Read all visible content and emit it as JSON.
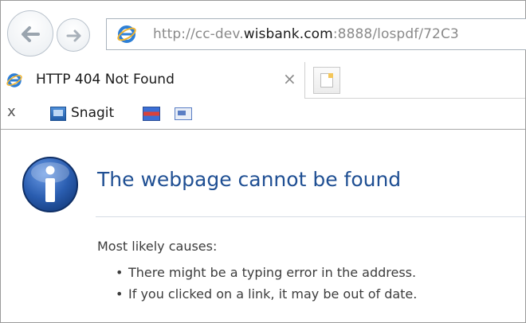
{
  "browser": {
    "address": {
      "url_prefix": "http://cc-dev.",
      "url_domain": "wisbank.com",
      "url_suffix": ":8888/lospdf/72C3"
    },
    "tab": {
      "title": "HTTP 404 Not Found",
      "close_label": "×"
    },
    "favorites_bar": {
      "close_label": "x",
      "items": [
        {
          "label": "Snagit",
          "icon": "snagit-icon"
        },
        {
          "label": "",
          "icon": "bookmark-icon"
        },
        {
          "label": "",
          "icon": "bookmark-icon"
        }
      ]
    }
  },
  "page": {
    "heading": "The webpage cannot be found",
    "causes_heading": "Most likely causes:",
    "causes": [
      "There might be a typing error in the address.",
      "If you clicked on a link, it may be out of date."
    ]
  },
  "colors": {
    "heading": "#1f4f93",
    "info_icon": "#2a5db0"
  }
}
